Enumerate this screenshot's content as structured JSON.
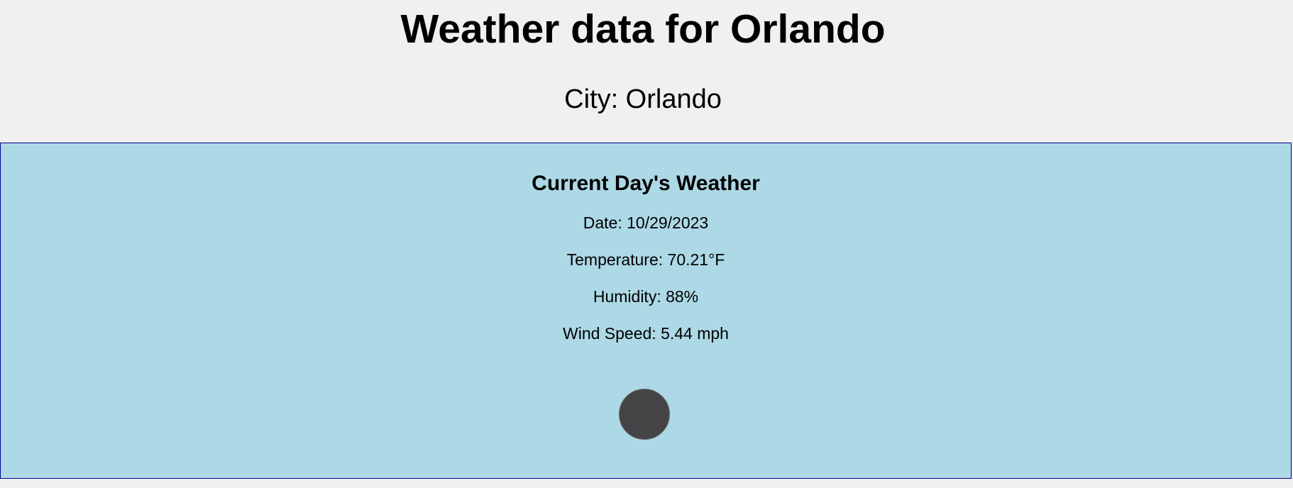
{
  "page": {
    "title": "Weather data for Orlando",
    "city_line": "City: Orlando"
  },
  "current": {
    "heading": "Current Day's Weather",
    "date": "Date: 10/29/2023",
    "temperature": "Temperature: 70.21°F",
    "humidity": "Humidity: 88%",
    "wind_speed": "Wind Speed: 5.44 mph",
    "icon": "weather-icon"
  },
  "colors": {
    "page_background": "#f0f0f0",
    "card_background": "#add8e6",
    "card_border": "#00008b",
    "icon_fill": "#454346"
  }
}
